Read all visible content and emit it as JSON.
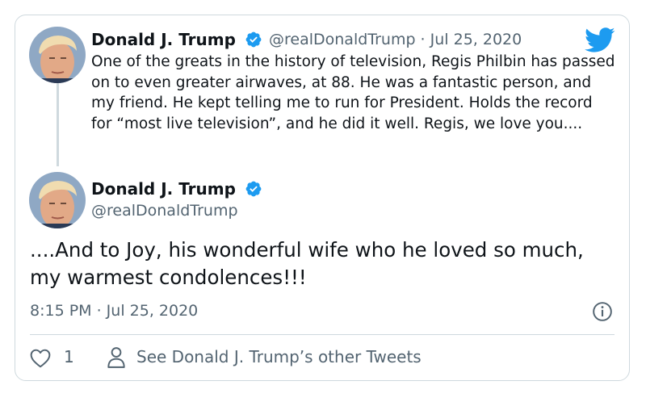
{
  "reply_tweet": {
    "author_name": "Donald J. Trump",
    "handle_date": "@realDonaldTrump · Jul 25, 2020",
    "text": "One of the greats in the history of television, Regis Philbin has passed on to even greater airwaves, at 88. He was a fantastic person, and my friend. He kept telling me to run for President. Holds the record for “most live television”, and he did it well. Regis, we love you....",
    "avatar_icon": "profile-photo",
    "verified_icon": "verified-badge-icon"
  },
  "main_tweet": {
    "author_name": "Donald J. Trump",
    "handle": "@realDonaldTrump",
    "text": "....And to Joy, his wonderful wife who he loved so much, my warmest condolences!!!",
    "timestamp": "8:15 PM · Jul 25, 2020",
    "verified_icon": "verified-badge-icon"
  },
  "actions": {
    "like_count": "1",
    "other_tweets_link": "See Donald J. Trump’s other Tweets",
    "like_icon": "heart-icon",
    "profile_icon": "person-icon",
    "info_icon": "info-icon"
  },
  "brand": {
    "logo_icon": "twitter-bird-icon",
    "accent_color": "#1d9bf0",
    "secondary_text_color": "#536471",
    "border_color": "#cfd9de"
  }
}
